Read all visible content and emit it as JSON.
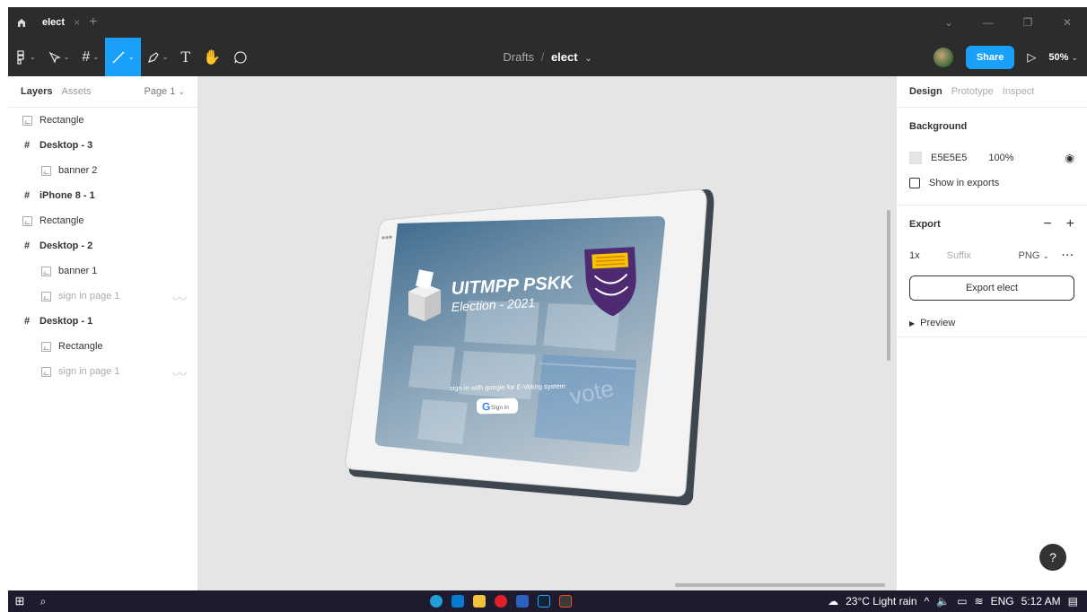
{
  "titlebar": {
    "tab_title": "elect",
    "tab_close": "×",
    "new_tab": "+",
    "minimize": "—",
    "restore": "❐",
    "close": "✕"
  },
  "toolbar": {
    "breadcrumb_folder": "Drafts",
    "breadcrumb_sep": "/",
    "file_name": "elect",
    "file_caret": "⌄",
    "share_label": "Share",
    "zoom": "50%"
  },
  "left_panel": {
    "tab_layers": "Layers",
    "tab_assets": "Assets",
    "page_label": "Page 1",
    "layers": [
      {
        "name": "Rectangle",
        "kind": "image",
        "level": 0,
        "hidden": false
      },
      {
        "name": "Desktop - 3",
        "kind": "frame",
        "level": 0,
        "hidden": false
      },
      {
        "name": "banner 2",
        "kind": "image",
        "level": 1,
        "hidden": false
      },
      {
        "name": "iPhone 8 - 1",
        "kind": "frame",
        "level": 0,
        "hidden": false
      },
      {
        "name": "Rectangle",
        "kind": "image",
        "level": 0,
        "hidden": false
      },
      {
        "name": "Desktop - 2",
        "kind": "frame",
        "level": 0,
        "hidden": false
      },
      {
        "name": "banner 1",
        "kind": "image",
        "level": 1,
        "hidden": false
      },
      {
        "name": "sign in page 1",
        "kind": "image",
        "level": 1,
        "hidden": true
      },
      {
        "name": "Desktop - 1",
        "kind": "frame",
        "level": 0,
        "hidden": false
      },
      {
        "name": "Rectangle",
        "kind": "image",
        "level": 1,
        "hidden": false
      },
      {
        "name": "sign in page 1",
        "kind": "image",
        "level": 1,
        "hidden": true
      }
    ]
  },
  "canvas": {
    "background": "#E5E5E5",
    "tablet_banner": {
      "title": "UITMPP PSKK",
      "subtitle": "Election - 2021",
      "signin_text": "sign in with google for E-Voting system",
      "signin_button": "Sign in",
      "keyboard_text": "vote"
    }
  },
  "right_panel": {
    "tab_design": "Design",
    "tab_prototype": "Prototype",
    "tab_inspect": "Inspect",
    "background_title": "Background",
    "bg_hex": "E5E5E5",
    "bg_opacity": "100%",
    "show_in_exports": "Show in exports",
    "export_title": "Export",
    "export_minus": "−",
    "export_plus": "+",
    "export_scale": "1x",
    "export_suffix_placeholder": "Suffix",
    "export_format": "PNG",
    "export_button": "Export elect",
    "preview_label": "Preview",
    "help": "?"
  },
  "taskbar": {
    "weather": "23°C  Light rain",
    "language": "ENG",
    "time": "5:12 AM"
  },
  "colors": {
    "accent": "#18a0fb",
    "toolbar_bg": "#2c2c2c",
    "canvas_bg": "#e5e5e5"
  }
}
